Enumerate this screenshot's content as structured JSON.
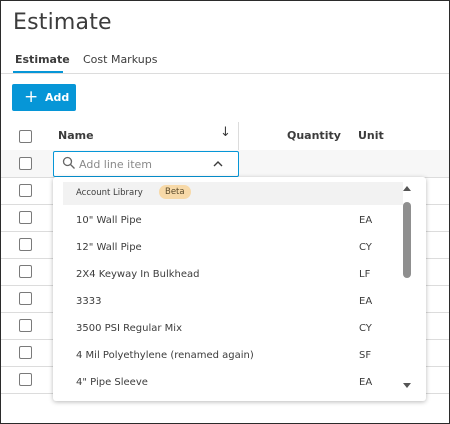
{
  "page": {
    "title": "Estimate"
  },
  "tabs": [
    {
      "label": "Estimate",
      "active": true
    },
    {
      "label": "Cost Markups",
      "active": false
    }
  ],
  "toolbar": {
    "add_label": "Add",
    "add_icon": "plus-icon"
  },
  "grid": {
    "columns": {
      "name": "Name",
      "quantity": "Quantity",
      "unit": "Unit"
    },
    "sort_icon": "arrow-down-icon",
    "row_count": 9
  },
  "search": {
    "placeholder": "Add line item",
    "value": "",
    "icon": "search-icon",
    "toggle_icon": "chevron-up-icon"
  },
  "dropdown": {
    "group_label": "Account Library",
    "group_badge": "Beta",
    "items": [
      {
        "name": "10\" Wall Pipe",
        "unit": "EA"
      },
      {
        "name": "12\" Wall Pipe",
        "unit": "CY"
      },
      {
        "name": "2X4 Keyway In Bulkhead",
        "unit": "LF"
      },
      {
        "name": "3333",
        "unit": "EA"
      },
      {
        "name": "3500 PSI Regular Mix",
        "unit": "CY"
      },
      {
        "name": "4 Mil Polyethylene (renamed again)",
        "unit": "SF"
      },
      {
        "name": "4\" Pipe Sleeve",
        "unit": "EA"
      }
    ]
  },
  "colors": {
    "accent": "#0696d7",
    "badge": "#f7d9a8",
    "border": "#dcdcdc"
  }
}
